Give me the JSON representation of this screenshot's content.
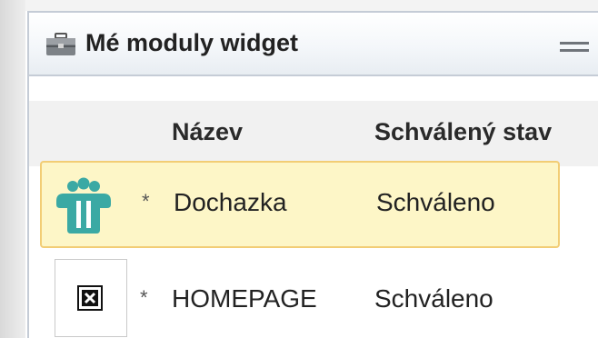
{
  "widget": {
    "title": "Mé moduly widget",
    "icons": {
      "title": "briefcase-icon",
      "menu": "menu-icon"
    }
  },
  "table": {
    "columns": [
      "Název",
      "Schválený stav"
    ],
    "rows": [
      {
        "icon": "people-app-icon",
        "marker": "*",
        "name": "Dochazka",
        "state": "Schváleno",
        "selected": true
      },
      {
        "icon": "broken-image-icon",
        "marker": "*",
        "name": "HOMEPAGE",
        "state": "Schváleno",
        "selected": false
      }
    ]
  },
  "colors": {
    "selected_row_bg": "#fdf6c7",
    "selected_row_border": "#f2cd75",
    "app_icon_teal": "#3ba9a4"
  }
}
